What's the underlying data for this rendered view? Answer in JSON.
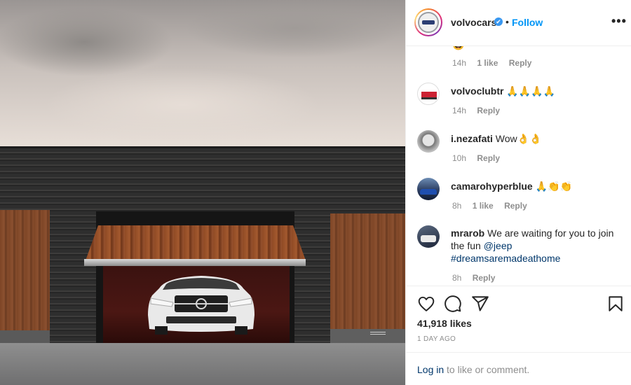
{
  "header": {
    "username": "volvocars",
    "verified_mark": "✔",
    "separator": "•",
    "follow_label": "Follow",
    "more_label": "•••"
  },
  "comments": {
    "partial": {
      "emoji": "🤩",
      "time": "14h",
      "likes": "1 like",
      "reply": "Reply"
    },
    "items": [
      {
        "user": "volvoclubtr",
        "text": "🙏🙏🙏🙏",
        "time": "14h",
        "likes": "",
        "reply": "Reply"
      },
      {
        "user": "i.nezafati",
        "text": "Wow👌👌",
        "time": "10h",
        "likes": "",
        "reply": "Reply"
      },
      {
        "user": "camarohyperblue",
        "text": "🙏👏👏",
        "time": "8h",
        "likes": "1 like",
        "reply": "Reply"
      },
      {
        "user": "mrarob",
        "text": "We are waiting for you to join the fun",
        "mention": "@jeep",
        "hashtag": "#dreamsaremadeathome",
        "time": "8h",
        "likes": "",
        "reply": "Reply"
      }
    ]
  },
  "post": {
    "likes": "41,918 likes",
    "date": "1 DAY AGO"
  },
  "footer": {
    "login_link": "Log in",
    "login_rest": "to like or comment."
  },
  "colors": {
    "accent": "#0095f6",
    "link": "#00376b",
    "muted": "#8e8e8e",
    "text": "#262626"
  }
}
